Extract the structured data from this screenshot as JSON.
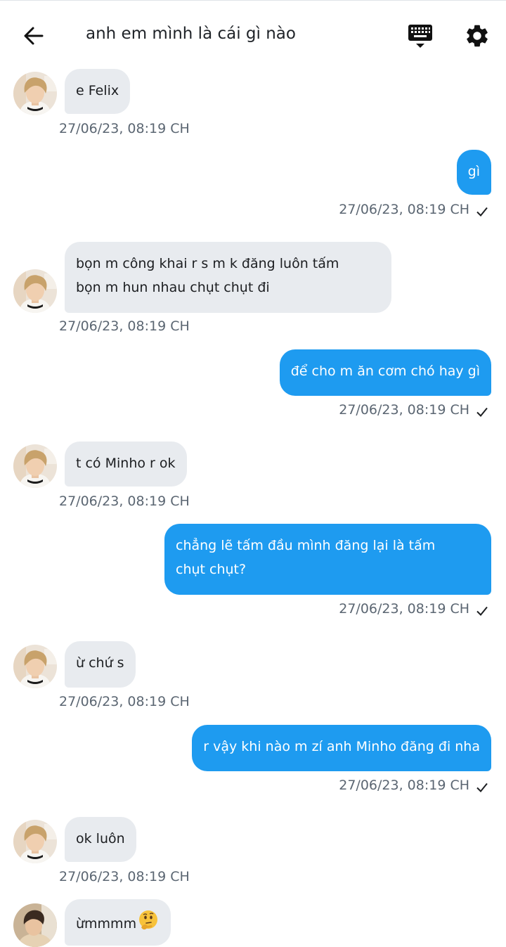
{
  "header": {
    "title": "anh em mình là cái gì nào",
    "back_icon": "arrow-left-icon",
    "keyboard_icon": "keyboard-icon",
    "settings_icon": "gear-icon"
  },
  "colors": {
    "outgoing_bubble": "#1e9bf0",
    "incoming_bubble": "#e8ebef",
    "timestamp": "#5b6672"
  },
  "messages": [
    {
      "direction": "in",
      "text": "e Felix",
      "time": "27/06/23,  08:19 CH"
    },
    {
      "direction": "out",
      "text": "gì",
      "time": "27/06/23,  08:19 CH",
      "read": true
    },
    {
      "direction": "in",
      "lines": [
        "bọn m công khai r s m k đăng luôn tấm",
        "bọn m hun nhau chụt chụt đi"
      ],
      "time": "27/06/23,  08:19 CH"
    },
    {
      "direction": "out",
      "text": "để cho m ăn cơm chó hay gì",
      "time": "27/06/23,  08:19 CH",
      "read": true
    },
    {
      "direction": "in",
      "text": "t có Minho r ok",
      "time": "27/06/23,  08:19 CH"
    },
    {
      "direction": "out",
      "lines": [
        "chẳng lẽ tấm đầu mình đăng lại là tấm",
        "chụt chụt?"
      ],
      "time": "27/06/23,  08:19 CH",
      "read": true
    },
    {
      "direction": "in",
      "text": "ừ chứ s",
      "time": "27/06/23,  08:19 CH"
    },
    {
      "direction": "out",
      "text": "r vậy khi nào m zí anh Minho đăng đi nha",
      "time": "27/06/23,  08:19 CH",
      "read": true
    },
    {
      "direction": "in",
      "text": "ok luôn",
      "time": "27/06/23,  08:19 CH"
    },
    {
      "direction": "in",
      "text": "ừmmmm",
      "emoji": "thinking-face-emoji"
    }
  ]
}
